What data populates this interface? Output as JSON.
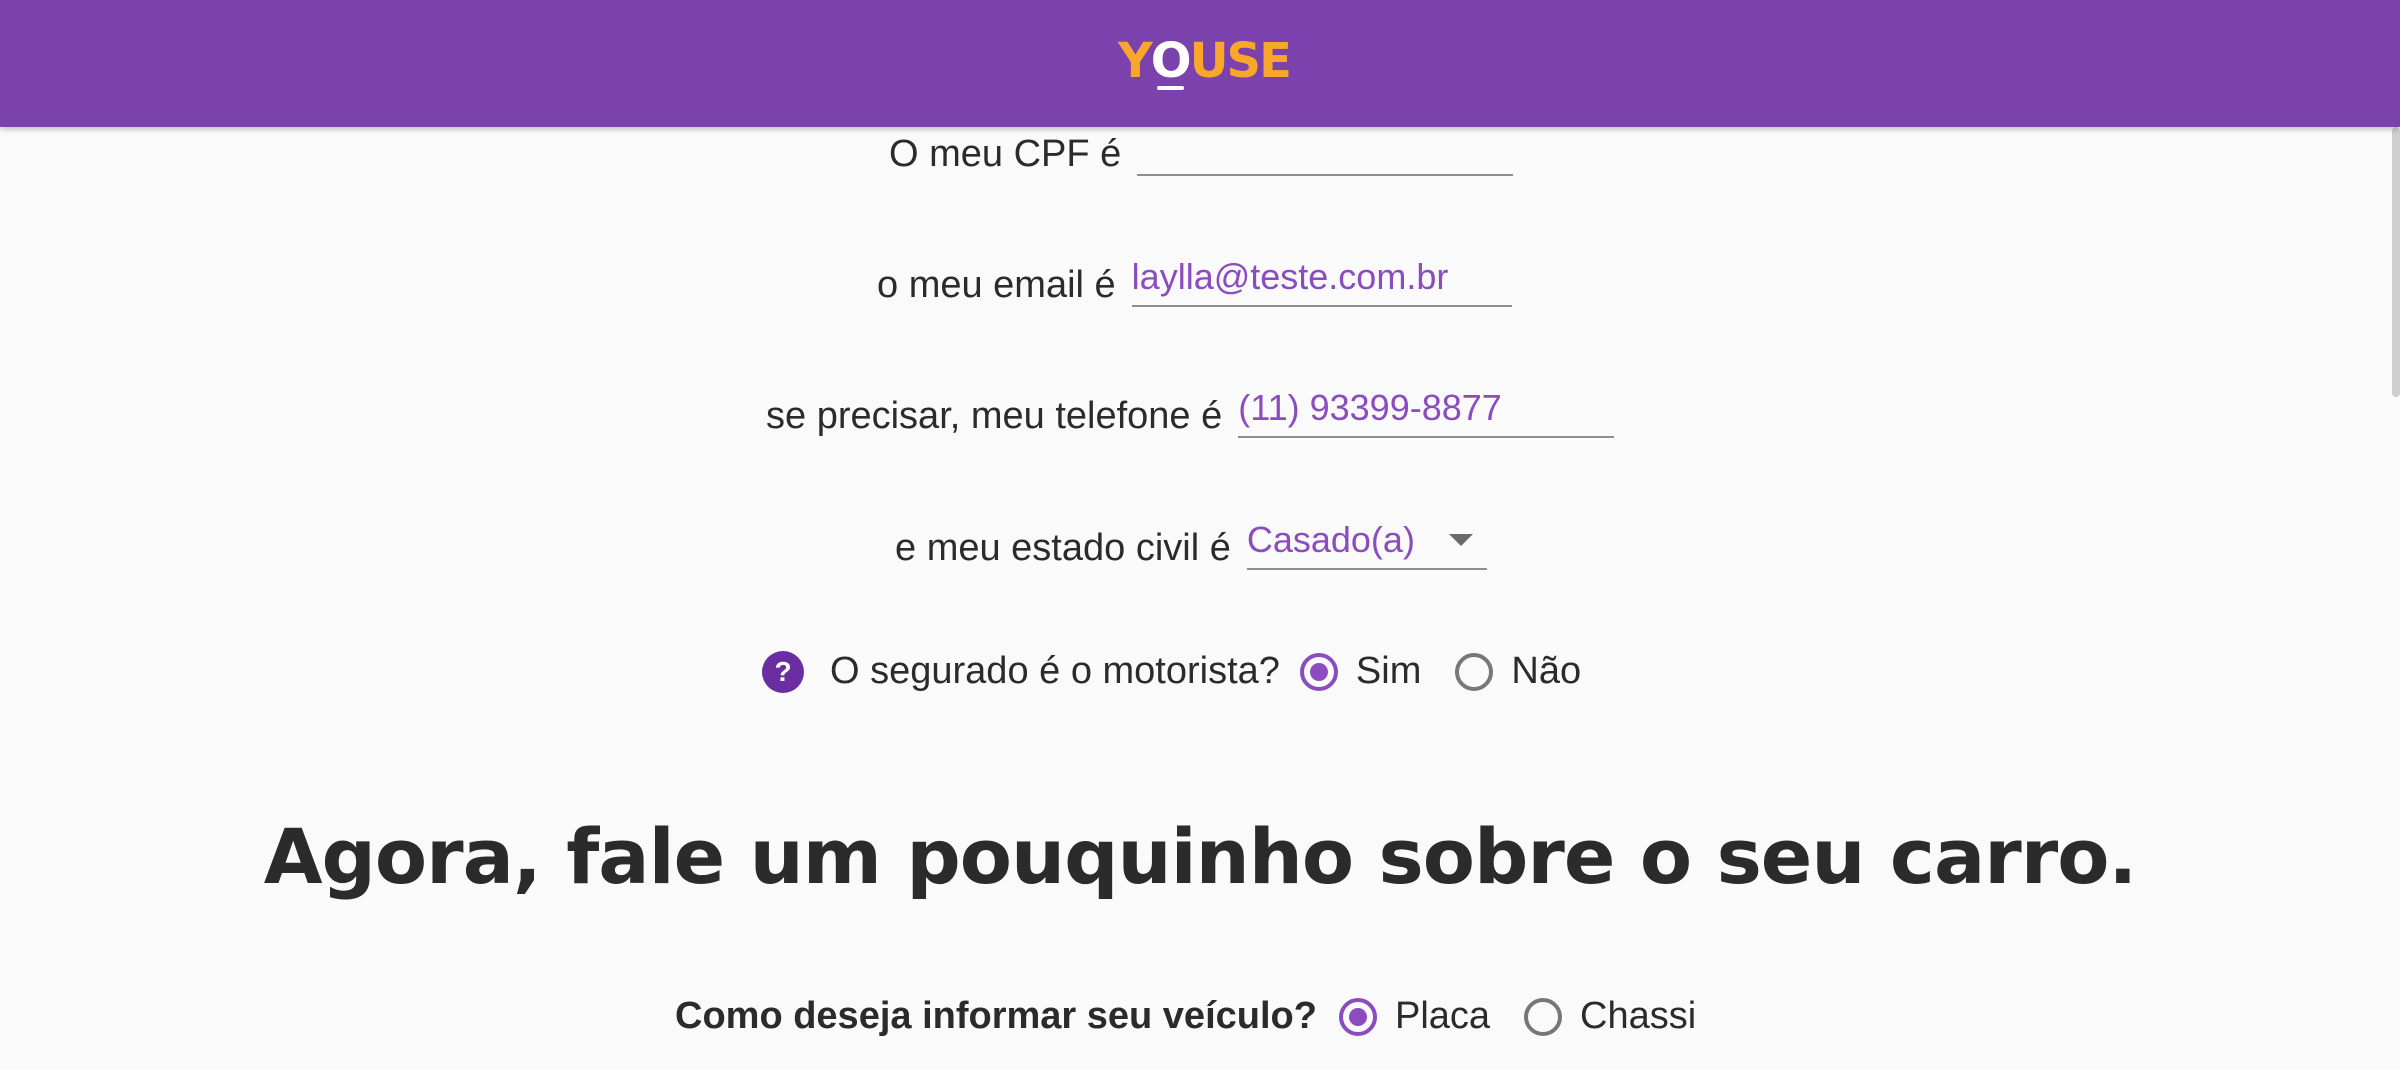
{
  "header": {
    "logo_y": "Y",
    "logo_o": "O",
    "logo_rest": "USE"
  },
  "form": {
    "cpf": {
      "label": "O meu CPF é",
      "value": ""
    },
    "email": {
      "label": "o meu email é",
      "value": "laylla@teste.com.br"
    },
    "phone": {
      "label": "se precisar, meu telefone é",
      "value": "(11) 93399-8877"
    },
    "marital": {
      "label": "e meu estado civil é",
      "value": "Casado(a)",
      "icon": "chevron-down-icon"
    },
    "driver": {
      "help_icon": "question-icon",
      "help_glyph": "?",
      "question": "O segurado é o motorista?",
      "options": [
        "Sim",
        "Não"
      ],
      "selected": "Sim"
    }
  },
  "car_section": {
    "heading": "Agora, fale um pouquinho sobre o seu carro.",
    "question": "Como deseja informar seu veículo?",
    "options": [
      "Placa",
      "Chassi"
    ],
    "selected": "Placa"
  },
  "colors": {
    "brand_purple": "#7b42ad",
    "accent_purple": "#8a4cbe",
    "logo_orange": "#f9a72b"
  }
}
